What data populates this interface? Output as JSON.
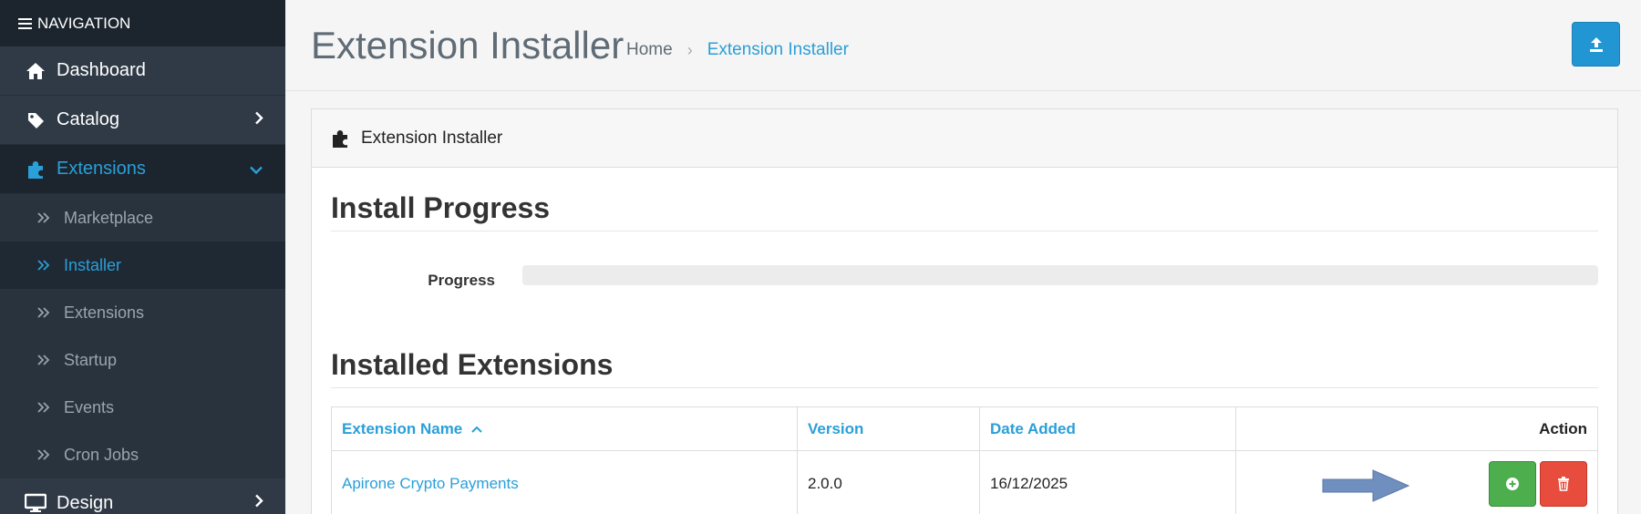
{
  "navigation": {
    "header": "NAVIGATION",
    "items": [
      {
        "label": "Dashboard",
        "icon": "home-icon"
      },
      {
        "label": "Catalog",
        "icon": "tag-icon"
      },
      {
        "label": "Extensions",
        "icon": "puzzle-icon",
        "active": true
      },
      {
        "label": "Design",
        "icon": "monitor-icon"
      }
    ],
    "sub_items": [
      {
        "label": "Marketplace"
      },
      {
        "label": "Installer",
        "active": true
      },
      {
        "label": "Extensions"
      },
      {
        "label": "Startup"
      },
      {
        "label": "Events"
      },
      {
        "label": "Cron Jobs"
      }
    ]
  },
  "header": {
    "title": "Extension Installer",
    "breadcrumb": {
      "home": "Home",
      "current": "Extension Installer"
    }
  },
  "panel": {
    "heading": "Extension Installer",
    "install_progress_title": "Install Progress",
    "progress_label": "Progress",
    "progress_value": 0,
    "installed_title": "Installed Extensions",
    "table": {
      "columns": {
        "name": "Extension Name",
        "version": "Version",
        "date": "Date Added",
        "action": "Action"
      },
      "rows": [
        {
          "name": "Apirone Crypto Payments",
          "version": "2.0.0",
          "date": "16/12/2025"
        }
      ]
    }
  },
  "colors": {
    "sidebar": "#2b3642",
    "accent": "#2a9fd8",
    "install": "#4cae4c",
    "delete": "#e74c3c",
    "arrow": "#6f8fbf"
  }
}
